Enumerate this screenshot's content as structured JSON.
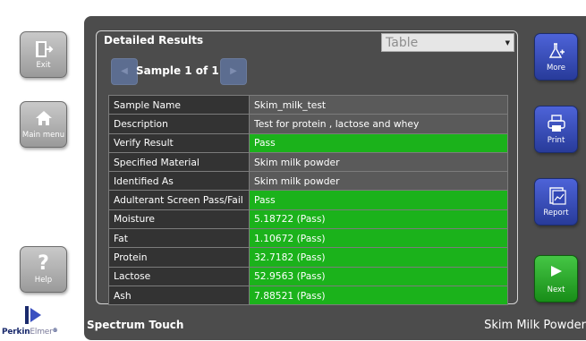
{
  "left_buttons": {
    "exit": {
      "label": "Exit",
      "icon": "exit-icon"
    },
    "main_menu": {
      "label": "Main menu",
      "icon": "home-icon"
    },
    "help": {
      "label": "Help",
      "icon": "question-icon"
    }
  },
  "right_buttons": {
    "more": {
      "label": "More",
      "icon": "flask-plus-icon"
    },
    "print": {
      "label": "Print",
      "icon": "printer-icon"
    },
    "report": {
      "label": "Report",
      "icon": "report-icon"
    },
    "next": {
      "label": "Next",
      "icon": "play-arrow-icon"
    }
  },
  "panel": {
    "title": "Detailed Results",
    "view_select": "Table",
    "sample_label": "Sample 1 of 1"
  },
  "results": [
    {
      "label": "Sample Name",
      "value": "Skim_milk_test",
      "status": "neutral"
    },
    {
      "label": "Description",
      "value": "Test for protein , lactose and whey",
      "status": "neutral"
    },
    {
      "label": "Verify Result",
      "value": "Pass",
      "status": "pass"
    },
    {
      "label": "Specified Material",
      "value": "Skim milk powder",
      "status": "neutral"
    },
    {
      "label": "Identified As",
      "value": "Skim milk powder",
      "status": "neutral"
    },
    {
      "label": "Adulterant Screen Pass/Fail",
      "value": "Pass",
      "status": "pass"
    },
    {
      "label": "Moisture",
      "value": "5.18722 (Pass)",
      "status": "pass"
    },
    {
      "label": "Fat",
      "value": "1.10672 (Pass)",
      "status": "pass"
    },
    {
      "label": "Protein",
      "value": "32.7182 (Pass)",
      "status": "pass"
    },
    {
      "label": "Lactose",
      "value": "52.9563 (Pass)",
      "status": "pass"
    },
    {
      "label": "Ash",
      "value": "7.88521 (Pass)",
      "status": "pass"
    }
  ],
  "status_bar": {
    "app_name": "Spectrum Touch",
    "material": "Skim Milk Powder"
  },
  "brand": {
    "name_part1": "Perkin",
    "name_part2": "Elmer",
    "trademark": "®",
    "color": "#1a2a6c"
  },
  "colors": {
    "pass": "#1bb21b",
    "neutral": "#5a5a5a",
    "label_bg": "#333333",
    "accent_blue": "#3a50c0",
    "next_green": "#2eae2e"
  }
}
